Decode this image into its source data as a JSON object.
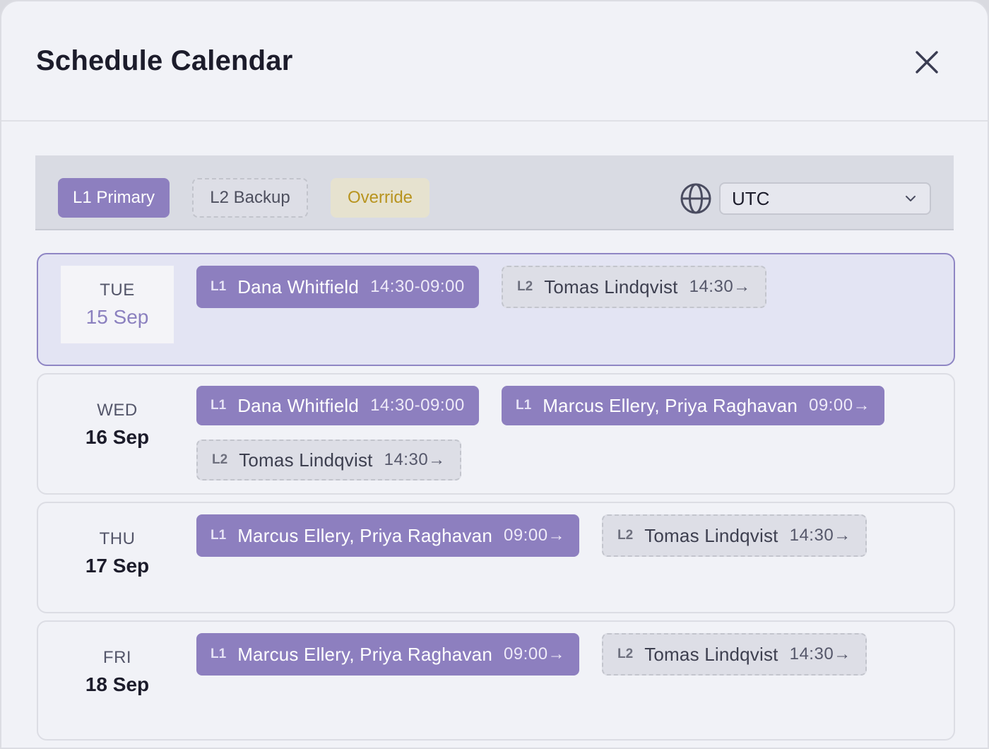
{
  "header": {
    "title": "Schedule Calendar",
    "close_icon": "close-icon"
  },
  "legend": {
    "primary": "L1 Primary",
    "backup": "L2 Backup",
    "override": "Override",
    "colors": {
      "primary": "#8d7fbf",
      "backup": "#dddee6",
      "override": "#e6e2cf",
      "override_text": "#b8941f"
    }
  },
  "timezone": {
    "icon": "globe-icon",
    "selected": "UTC",
    "chevron_icon": "chevron-down-icon"
  },
  "days": [
    {
      "dow": "TUE",
      "date": "15 Sep",
      "selected": true,
      "shifts": [
        {
          "level": "L1",
          "who": "Dana Whitfield",
          "when": "14:30-09:00"
        },
        {
          "level": "L2",
          "who": "Tomas Lindqvist",
          "when": "14:30→"
        }
      ]
    },
    {
      "dow": "WED",
      "date": "16 Sep",
      "selected": false,
      "shifts": [
        {
          "level": "L1",
          "who": "Dana Whitfield",
          "when": "14:30-09:00"
        },
        {
          "level": "L1",
          "who": "Marcus Ellery, Priya Raghavan",
          "when": "09:00→"
        },
        {
          "level": "L2",
          "who": "Tomas Lindqvist",
          "when": "14:30→"
        }
      ]
    },
    {
      "dow": "THU",
      "date": "17 Sep",
      "selected": false,
      "shifts": [
        {
          "level": "L1",
          "who": "Marcus Ellery, Priya Raghavan",
          "when": "09:00→"
        },
        {
          "level": "L2",
          "who": "Tomas Lindqvist",
          "when": "14:30→"
        }
      ]
    },
    {
      "dow": "FRI",
      "date": "18 Sep",
      "selected": false,
      "shifts": [
        {
          "level": "L1",
          "who": "Marcus Ellery, Priya Raghavan",
          "when": "09:00→"
        },
        {
          "level": "L2",
          "who": "Tomas Lindqvist",
          "when": "14:30→"
        }
      ]
    }
  ]
}
